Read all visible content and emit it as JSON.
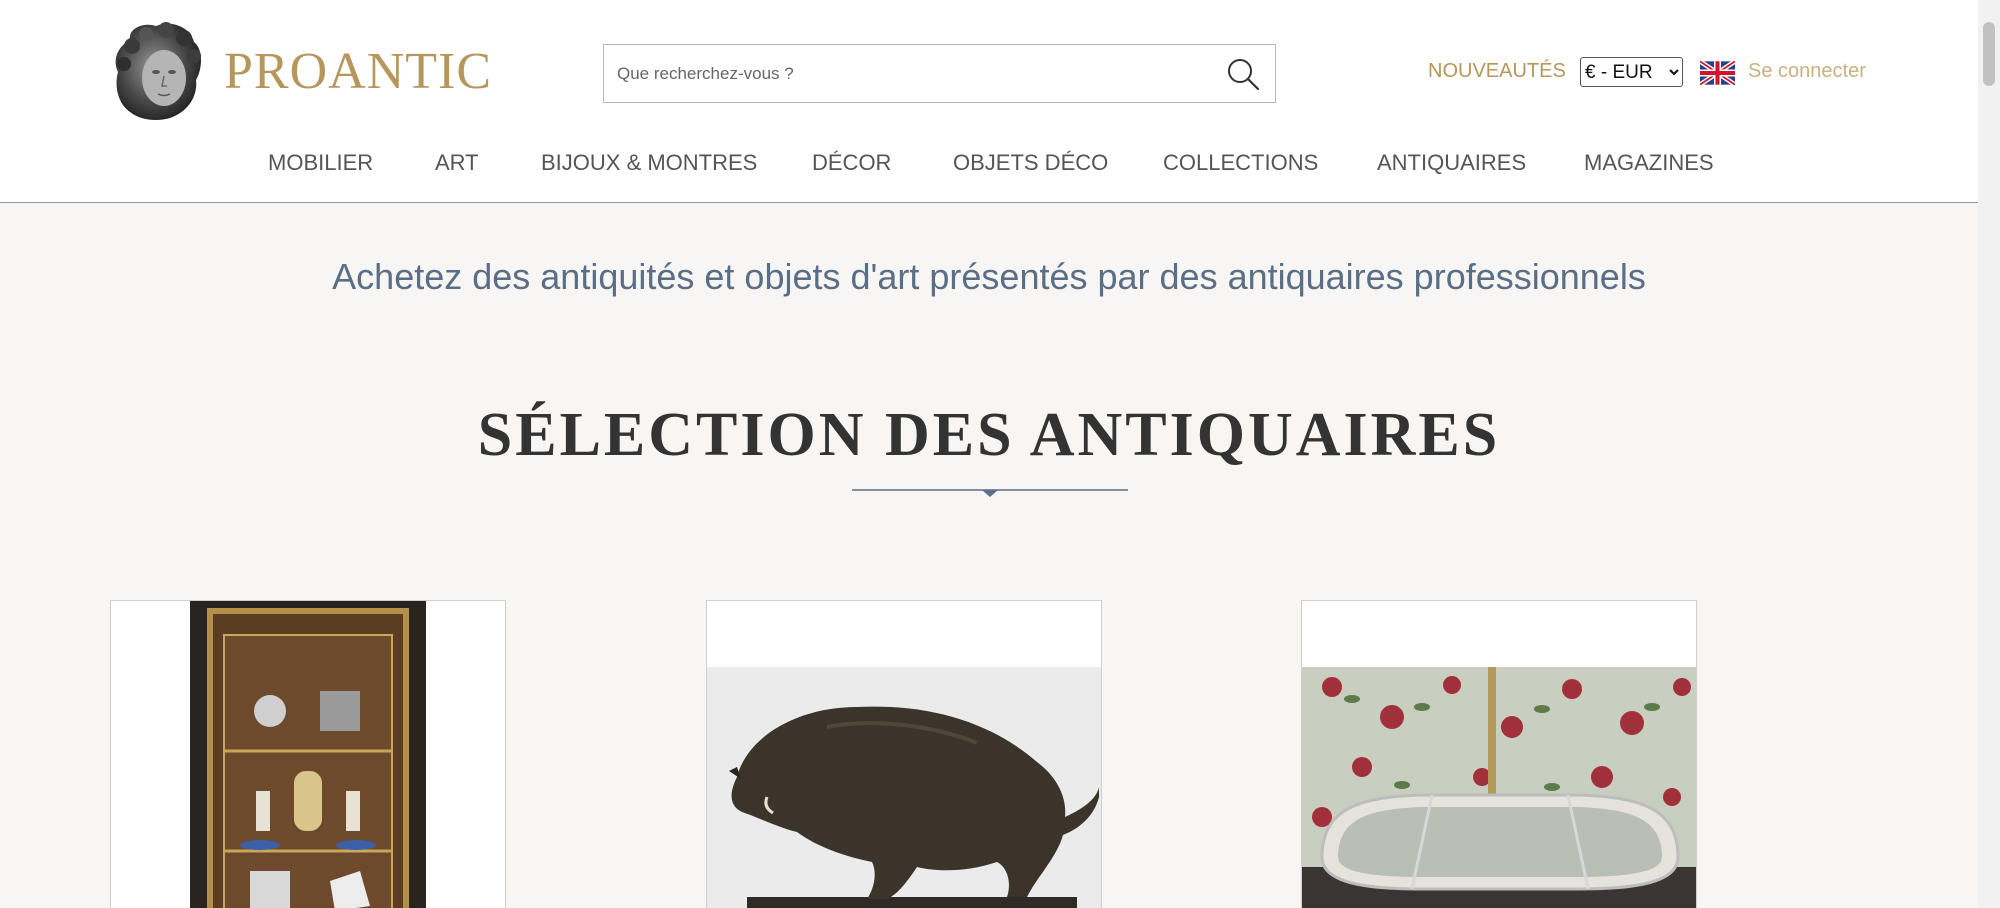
{
  "brand": {
    "name": "PROANTIC",
    "color": "#b6965b"
  },
  "search": {
    "placeholder": "Que recherchez-vous ?",
    "icon": "search-icon"
  },
  "header": {
    "news_label": "NOUVEAUTÉS",
    "currency_selected": "€ - EUR",
    "language_flag": "uk-flag-icon",
    "login_label": "Se connecter"
  },
  "nav": {
    "items": [
      {
        "label": "MOBILIER"
      },
      {
        "label": "ART"
      },
      {
        "label": "BIJOUX & MONTRES"
      },
      {
        "label": "DÉCOR"
      },
      {
        "label": "OBJETS DÉCO"
      },
      {
        "label": "COLLECTIONS"
      },
      {
        "label": "ANTIQUAIRES"
      },
      {
        "label": "MAGAZINES"
      }
    ]
  },
  "main": {
    "tagline": "Achetez des antiquités et objets d'art présentés par des antiquaires professionnels",
    "section_title": "SÉLECTION DES ANTIQUAIRES"
  },
  "cards": [
    {
      "image": "display-cabinet-photo"
    },
    {
      "image": "bronze-boar-photo"
    },
    {
      "image": "mirrored-tray-photo"
    }
  ],
  "colors": {
    "accent_gold": "#b6965b",
    "login_gold": "#c9b27f",
    "tagline_blue": "#5a6e85",
    "background": "#f7f6f4"
  }
}
